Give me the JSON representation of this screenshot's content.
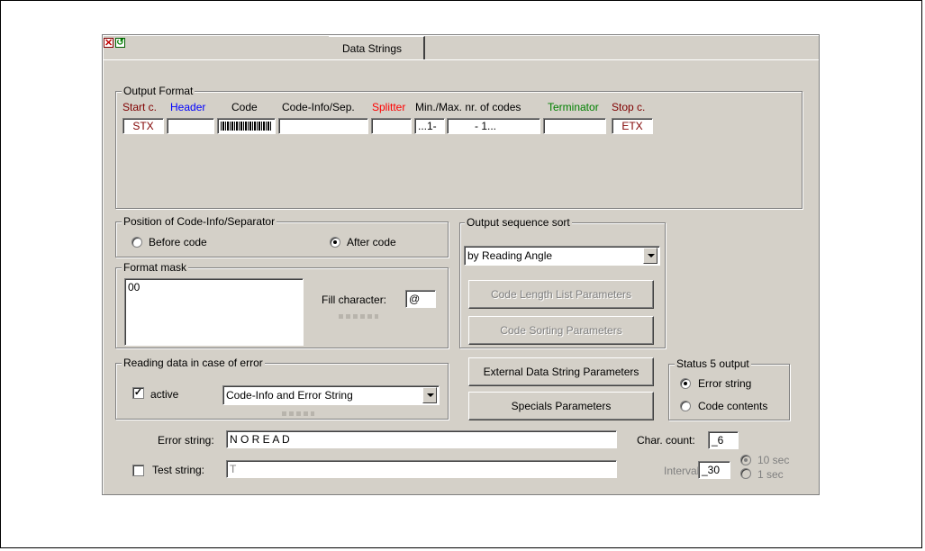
{
  "title_bar": {
    "close_icon": "close-icon",
    "restore_icon": "restore-icon"
  },
  "tab": {
    "label": "Data Strings"
  },
  "output_format": {
    "legend": "Output Format",
    "columns": {
      "start": "Start c.",
      "header": "Header",
      "code": "Code",
      "code_info": "Code-Info/Sep.",
      "splitter": "Splitter",
      "minmax": "Min./Max. nr. of codes",
      "terminator": "Terminator",
      "stop": "Stop c."
    },
    "colors": {
      "start": "#800000",
      "header": "#0000ff",
      "splitter": "#ff0000",
      "terminator": "#008000",
      "stop": "#800000"
    },
    "values": {
      "start": "STX",
      "header": "",
      "code_icon": "barcode-icon",
      "code_info": "",
      "splitter": "",
      "min": "...1-",
      "max": "- 1...",
      "terminator": "",
      "stop": "ETX"
    }
  },
  "position": {
    "legend": "Position of Code-Info/Separator",
    "before": "Before code",
    "after": "After code",
    "selected": "after"
  },
  "format_mask": {
    "legend": "Format mask",
    "value": "00",
    "fill_label": "Fill character:",
    "fill_value": "@"
  },
  "sequence_sort": {
    "legend": "Output sequence sort",
    "selected": "by Reading Angle",
    "btn_code_length": "Code Length List Parameters",
    "btn_code_sorting": "Code Sorting Parameters"
  },
  "error_reading": {
    "legend": "Reading data in case of error",
    "active_label": "active",
    "active": true,
    "selected": "Code-Info and Error String"
  },
  "buttons": {
    "external": "External Data String Parameters",
    "specials": "Specials Parameters"
  },
  "status5": {
    "legend": "Status 5 output",
    "opt1": "Error string",
    "opt2": "Code contents",
    "selected": "opt1"
  },
  "error_string": {
    "label": "Error string:",
    "value": "N O R E A D"
  },
  "char_count": {
    "label": "Char. count:",
    "value": "_6"
  },
  "test_string": {
    "label": "Test string:",
    "value": "T",
    "checked": false
  },
  "interval": {
    "label": "Interval:",
    "value": "_30",
    "opt1": "10 sec",
    "opt2": "1 sec"
  }
}
